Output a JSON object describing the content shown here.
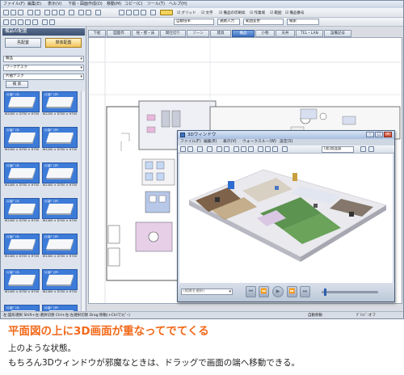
{
  "app": {
    "menubar": [
      {
        "label": "ファイル(F)"
      },
      {
        "label": "編集(E)"
      },
      {
        "label": "表示(V)"
      },
      {
        "label": "下絵・図面作成(D)"
      },
      {
        "label": "移動(M)"
      },
      {
        "label": "コピー(C)"
      },
      {
        "label": "ツール(T)"
      },
      {
        "label": "ヘルプ(H)"
      }
    ],
    "toolbar": {
      "checkboxes": [
        {
          "label": "グリッド"
        },
        {
          "label": "文字"
        },
        {
          "label": "備品の印刷枠"
        },
        {
          "label": "作業域"
        },
        {
          "label": "範囲"
        },
        {
          "label": "備品番号"
        }
      ],
      "scale_combo": "自動倍率",
      "input_label": "通路入力",
      "layout_combo": "範囲変更",
      "search_combo": "検索"
    },
    "tabs": [
      {
        "label": "下絵"
      },
      {
        "label": "図面作"
      },
      {
        "label": "柱・壁・床"
      },
      {
        "label": "間仕切り"
      },
      {
        "label": "ゾーン"
      },
      {
        "label": "建具"
      },
      {
        "label": "備品"
      },
      {
        "label": "小物"
      },
      {
        "label": "天井"
      },
      {
        "label": "TEL・LAN"
      },
      {
        "label": "設備記号"
      }
    ],
    "active_tab_index": 6,
    "left_panel": {
      "title": "備品の配置",
      "mode_buttons": [
        {
          "label": "島配置"
        },
        {
          "label": "単体配置"
        }
      ],
      "selects": [
        {
          "value": "備品"
        },
        {
          "value": "ワークデスク"
        },
        {
          "value": "片袖デスク"
        }
      ],
      "search_label": "検 索",
      "items": [
        {
          "name": "片袖ﾃﾞｽｸL",
          "size": "W1000 × D700 × H700"
        },
        {
          "name": "片袖ﾃﾞｽｸR",
          "size": "W1200 × D700 × H700"
        },
        {
          "name": "片袖ﾃﾞｽｸL",
          "size": "W1000 × D700 × H700"
        },
        {
          "name": "片袖ﾃﾞｽｸR",
          "size": "W1200 × D700 × H700"
        },
        {
          "name": "片袖ﾃﾞｽｸL",
          "size": "W1400 × D700 × H700"
        },
        {
          "name": "片袖ﾃﾞｽｸR",
          "size": "W1400 × D700 × H700"
        },
        {
          "name": "片袖ﾃﾞｽｸL",
          "size": "W1400 × D700 × H700"
        },
        {
          "name": "片袖ﾃﾞｽｸR",
          "size": "W1400 × D700 × H700"
        },
        {
          "name": "片袖ﾃﾞｽｸL",
          "size": "W1400 × D700 × H700"
        },
        {
          "name": "片袖ﾃﾞｽｸR",
          "size": "W1400 × D700 × H700"
        },
        {
          "name": "片袖ﾃﾞｽｸL",
          "size": "W1400 × D700 × H700"
        },
        {
          "name": "片袖ﾃﾞｽｸR",
          "size": "W1400 × D700 × H700"
        },
        {
          "name": "片袖ﾃﾞｽｸL",
          "size": "W1400 × D700 × H700"
        },
        {
          "name": "片袖ﾃﾞｽｸR",
          "size": "W1400 × D700 × H700"
        }
      ]
    },
    "statusbar": {
      "hint": "左:図形選択 Shift+左:選択切替 Ctrl+左:左選択切替 Drag:移動(+Ctrlでｺﾋﾟｰ)",
      "mode": "自動移動",
      "snap": "ｸﾞﾘｯﾄﾞ:オフ"
    }
  },
  "window3d": {
    "title": "3Dウィンドウ",
    "menu": [
      {
        "label": "ファイル(F)"
      },
      {
        "label": "編集(E)"
      },
      {
        "label": "表示(V)"
      },
      {
        "label": "ウォークスルー(W)"
      },
      {
        "label": "設定(S)"
      }
    ],
    "view_combo": "(高)高品質",
    "waypoint_select": "(経路を選択)",
    "slider_value": 0.05
  },
  "caption": {
    "headline": "平面図の上に3D画面が重なってでてくる",
    "line1": "上のような状態。",
    "line2": "もちろん3Dウィンドウが邪魔なときは、ドラッグで画面の端へ移動できる。"
  },
  "colors": {
    "accent_orange": "#f26a1b",
    "tab_active": "#3f74c4",
    "thumb_blue": "#3d7bd8"
  }
}
